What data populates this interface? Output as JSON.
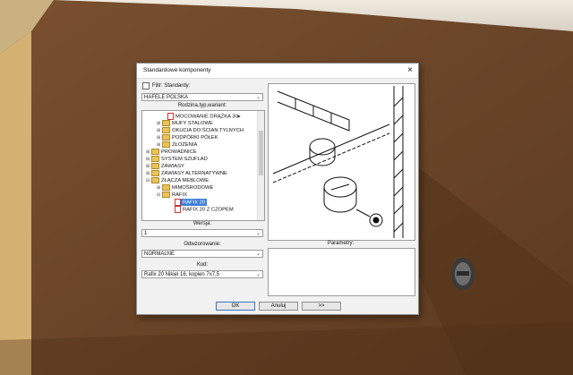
{
  "dialog": {
    "title": "Standardowe komponenty",
    "close_glyph": "×",
    "filter_label": "Filtr: Standardy:",
    "manufacturer": "HAFELE POLSKA",
    "family_label": "Rodzina,typ,wariant:",
    "tree": [
      {
        "label": "MOCOWANIE DRĄŻKA 30▸",
        "kind": "doc"
      },
      {
        "label": "MUFY STALOWE",
        "kind": "folder"
      },
      {
        "label": "OKUCIA DO ŚCIAN TYLNYCH",
        "kind": "folder"
      },
      {
        "label": "PODPÓRKI PÓŁEK",
        "kind": "folder"
      },
      {
        "label": "ZŁOŻENIA",
        "kind": "folder"
      },
      {
        "label": "PROWADNICE",
        "kind": "folder"
      },
      {
        "label": "SYSTEM SZUFLAD",
        "kind": "folder"
      },
      {
        "label": "ZAWIASY",
        "kind": "folder"
      },
      {
        "label": "ZAWIASY ALTERNATYWNE",
        "kind": "folder"
      },
      {
        "label": "ZŁĄCZA MEBLOWE",
        "kind": "folder"
      },
      {
        "label": "MIMOŚRODOWE",
        "kind": "folder"
      },
      {
        "label": "RAFIX",
        "kind": "folder"
      },
      {
        "label": "RAFIX 20",
        "kind": "doc"
      },
      {
        "label": "RAFIX 20 Z CZOPEM",
        "kind": "doc"
      }
    ],
    "version_label": "Wersja:",
    "version_value": "1",
    "ref_label": "Odwzorowanie:",
    "ref_value": "NORMALNE",
    "code_label": "Kod:",
    "code_value": "Rafix 20 Nikiel 16, kopien 7x7,5",
    "params_label": "Parametry:",
    "ok": "OK",
    "cancel": "Anuluj",
    "more": ">>"
  },
  "colors": {
    "wood": "#6b4527",
    "selection": "#3d7fd6"
  },
  "icons": [
    "close-icon",
    "folder-icon",
    "document-icon",
    "chevron-down-icon",
    "expand-icon"
  ]
}
